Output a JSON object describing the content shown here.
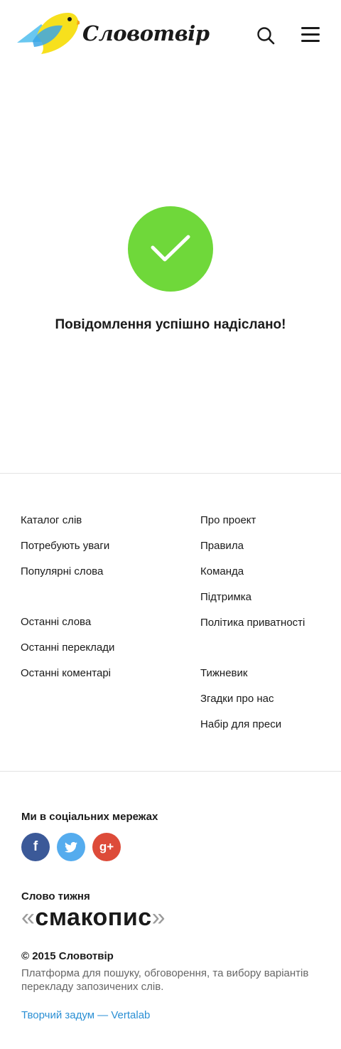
{
  "header": {
    "logo_text": "Словотвір",
    "search_icon": "search-icon",
    "menu_icon": "hamburger-menu-icon"
  },
  "success": {
    "icon": "checkmark-icon",
    "message": "Повідомлення успішно надіслано!",
    "color": "#6fd83a"
  },
  "footer_nav": {
    "left": [
      [
        "Каталог слів",
        "Потребують уваги",
        "Популярні слова"
      ],
      [
        "Останні слова",
        "Останні переклади",
        "Останні коментарі"
      ]
    ],
    "right": [
      [
        "Про проект",
        "Правила",
        "Команда",
        "Підтримка",
        "Політика приватності"
      ],
      [
        "Тижневик",
        "Згадки про нас",
        "Набір для преси"
      ]
    ]
  },
  "social": {
    "title": "Ми в соціальних мережах",
    "networks": [
      {
        "name": "facebook-icon",
        "glyph": "f",
        "color": "#3b5998"
      },
      {
        "name": "twitter-icon",
        "glyph": "",
        "color": "#55acee"
      },
      {
        "name": "google-plus-icon",
        "glyph": "g+",
        "color": "#dd4b39"
      }
    ]
  },
  "word_of_week": {
    "title": "Слово тижня",
    "open_quote": "«",
    "word": "смакопис",
    "close_quote": "»"
  },
  "copyright": {
    "title": "© 2015 Словотвір",
    "description": "Платформа для пошуку, обговорення, та вибору варіантів перекладу запозичених слів.",
    "credit": "Творчий задум — Vertalab"
  },
  "colors": {
    "accent": "#6fd83a",
    "link": "#2a8fd4",
    "divider": "#e3e3e3"
  }
}
